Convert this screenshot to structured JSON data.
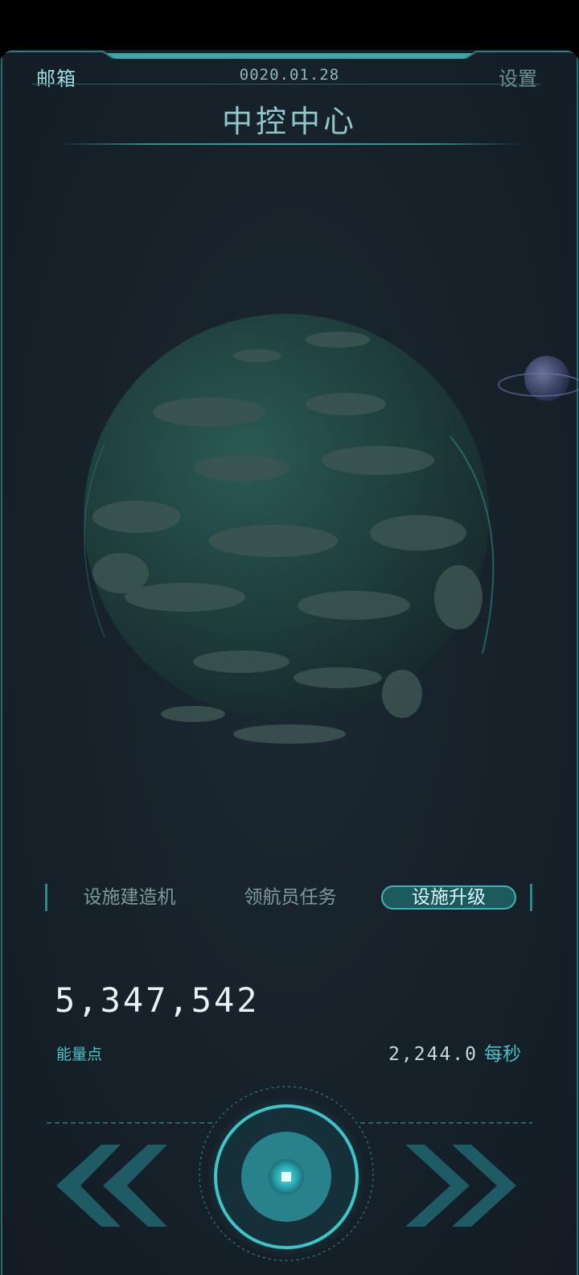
{
  "header": {
    "mail_label": "邮箱",
    "date": "0020.01.28",
    "settings_label": "设置"
  },
  "title": "中控中心",
  "tabs": [
    {
      "label": "设施建造机",
      "active": false
    },
    {
      "label": "领航员任务",
      "active": false
    },
    {
      "label": "设施升级",
      "active": true
    }
  ],
  "energy": {
    "value": "5,347,542",
    "label": "能量点",
    "rate_value": "2,244.0",
    "rate_unit": "每秒"
  },
  "controls": {
    "prev_icon": "double-chevron-left-icon",
    "center_icon": "power-core-button-icon",
    "next_icon": "double-chevron-right-icon"
  },
  "colors": {
    "accent": "#3fb4b6",
    "background": "#17222b",
    "text_light": "#e6f1f2"
  }
}
